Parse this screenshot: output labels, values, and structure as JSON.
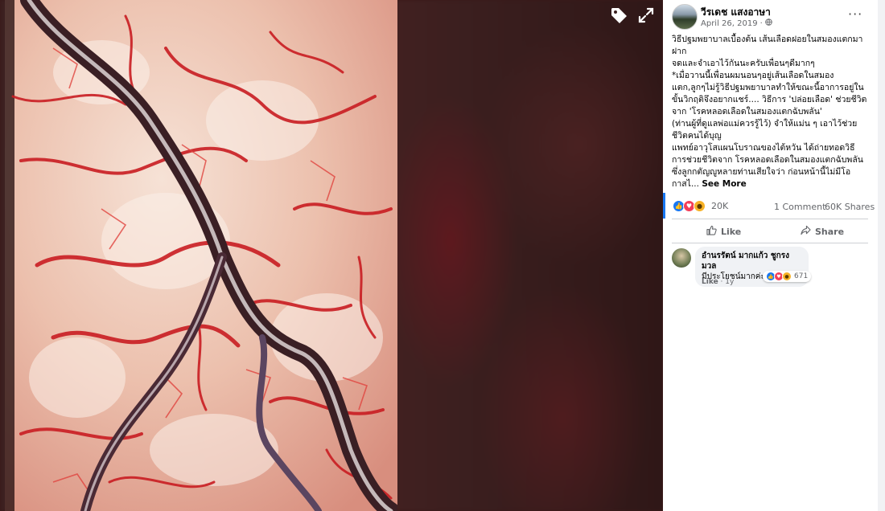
{
  "viewer": {
    "image_alt": "brain blood vessels photo",
    "tag_icon": "tag-icon",
    "expand_icon": "expand-icon"
  },
  "post": {
    "author": "วีรเดช แสงอาษา",
    "date": "April 26, 2019",
    "separator": "·",
    "privacy_icon": "globe-icon",
    "more_icon": "···",
    "lines": [
      "วิธีปฐมพยาบาลเบื้องต้น เส้นเลือดฝอยในสมองแตกมา",
      "ฝาก",
      "จดและจำเอาไว้กันนะครับเพื่อนๆดีมากๆ",
      "*เมื่อวานนี้เพื่อนผมนอนๆอยู่เส้นเลือดในสมอง",
      "แตก,ลูกๆไม่รู้วิธีปฐมพยาบาลทำให้ขณะนี้อาการอยู่ใน",
      "ขั้นวิกฤติจึงอยากแชร์.... วิธีการ 'ปล่อยเลือด' ช่วยชีวิต",
      "จาก 'โรคหลอดเลือดในสมองแตกฉับพลัน'",
      "(ท่านผู้ที่ดูแลพ่อแม่ควรรู้ไว้) จำให้แม่น ๆ เอาไว้ช่วย",
      "ชีวิตคนได้บุญ",
      "แพทย์อาวุโสแผนโบราณของไต้หวัน ได้ถ่ายทอดวิธี",
      "การช่วยชีวิตจาก โรคหลอดเลือดในสมองแตกฉับพลัน",
      "ซึ่งลูกกตัญญูหลายท่านเสียใจว่า ก่อนหน้านี้ไม่มีโอ"
    ],
    "last_line": "กาสไ...",
    "see_more": "See More",
    "reaction_count": "20K",
    "comments_count": "1 Comment",
    "shares_count": "60K Shares",
    "like_label": "Like",
    "share_label": "Share"
  },
  "comment": {
    "author": "อำนรรัตน์ มากแก้ว ชูกรงมวล",
    "text": "มีประโยชน์มากค่ะ",
    "reaction_count": "671",
    "like_label": "Like",
    "separator": "·",
    "time": "1y"
  },
  "colors": {
    "accent": "#1877f2",
    "like": "#1877f2",
    "love": "#f33e58",
    "wow": "#f7b125",
    "muted_text": "#65676b"
  }
}
